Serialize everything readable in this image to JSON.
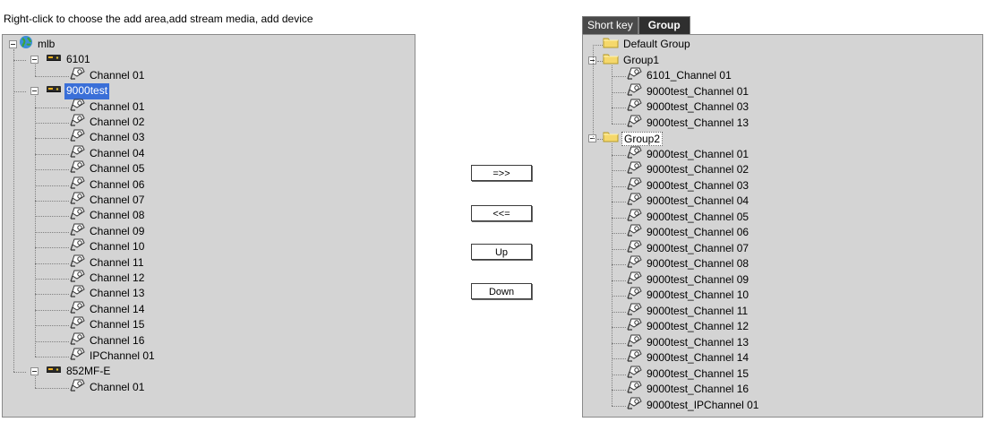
{
  "hint_text": "Right-click to choose the add area,add stream media, add device",
  "left_tree": {
    "root_label": "mlb",
    "devices": [
      {
        "label": "6101",
        "selected": false,
        "channels": [
          "Channel 01"
        ]
      },
      {
        "label": "9000test",
        "selected": true,
        "channels": [
          "Channel 01",
          "Channel 02",
          "Channel 03",
          "Channel 04",
          "Channel 05",
          "Channel 06",
          "Channel 07",
          "Channel 08",
          "Channel 09",
          "Channel 10",
          "Channel 11",
          "Channel 12",
          "Channel 13",
          "Channel 14",
          "Channel 15",
          "Channel 16",
          "IPChannel 01"
        ]
      },
      {
        "label": "852MF-E",
        "selected": false,
        "channels": [
          "Channel 01"
        ]
      }
    ]
  },
  "buttons": {
    "add": "=>>",
    "remove": "<<=",
    "up": "Up",
    "down": "Down"
  },
  "tabs": [
    {
      "label": "Short key",
      "active": false
    },
    {
      "label": "Group",
      "active": true
    }
  ],
  "right_tree": {
    "groups": [
      {
        "label": "Default Group",
        "expandable": false,
        "outlined": false,
        "channels": []
      },
      {
        "label": "Group1",
        "expandable": true,
        "outlined": false,
        "channels": [
          "6101_Channel 01",
          "9000test_Channel 01",
          "9000test_Channel 03",
          "9000test_Channel 13"
        ]
      },
      {
        "label": "Group2",
        "expandable": true,
        "outlined": true,
        "channels": [
          "9000test_Channel 01",
          "9000test_Channel 02",
          "9000test_Channel 03",
          "9000test_Channel 04",
          "9000test_Channel 05",
          "9000test_Channel 06",
          "9000test_Channel 07",
          "9000test_Channel 08",
          "9000test_Channel 09",
          "9000test_Channel 10",
          "9000test_Channel 11",
          "9000test_Channel 12",
          "9000test_Channel 13",
          "9000test_Channel 14",
          "9000test_Channel 15",
          "9000test_Channel 16",
          "9000test_IPChannel 01"
        ]
      }
    ]
  },
  "icons": {
    "root": "globe-icon",
    "device": "dvr-device-icon",
    "channel": "camera-icon",
    "group": "folder-icon"
  },
  "colors": {
    "panel_bg": "#d4d4d4",
    "selection_bg": "#3a6fd8",
    "tab_bg": "#4a4a4a",
    "folder": "#f5d86b"
  }
}
